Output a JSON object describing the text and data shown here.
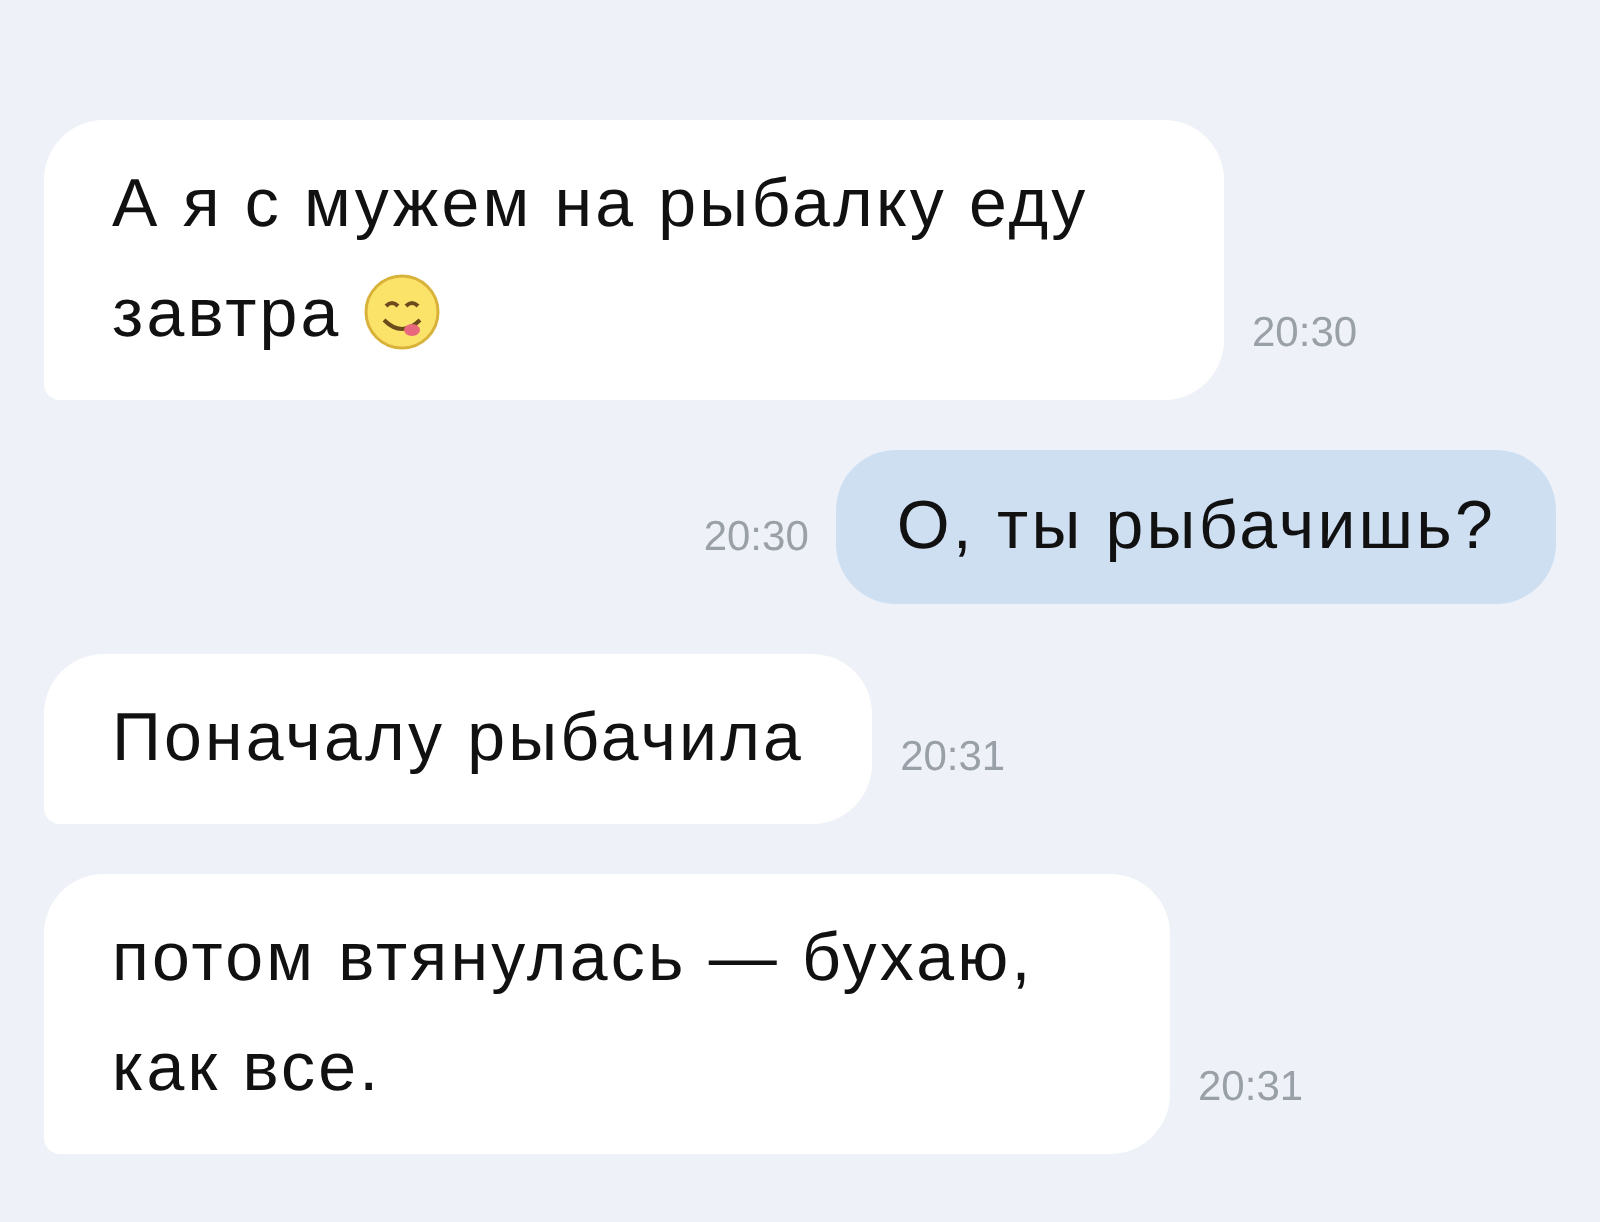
{
  "messages": [
    {
      "kind": "incoming",
      "text": "А я с мужем на рыбалку еду завтра",
      "emoji": true,
      "time": "20:30"
    },
    {
      "kind": "outgoing",
      "text": "О, ты рыбачишь?",
      "emoji": false,
      "time": "20:30"
    },
    {
      "kind": "incoming",
      "text": "Поначалу рыбачила",
      "emoji": false,
      "time": "20:31"
    },
    {
      "kind": "incoming",
      "text": "потом втянулась — бухаю, как все.",
      "emoji": false,
      "time": "20:31"
    }
  ]
}
